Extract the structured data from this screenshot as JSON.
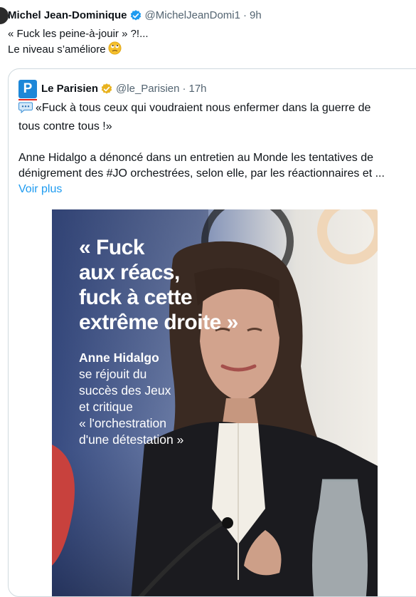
{
  "tweet": {
    "author_name": "Michel Jean-Dominique",
    "author_handle": "@MichelJeanDomi1",
    "separator": "·",
    "time": "9h",
    "text_line1": "« Fuck les peine-à-jouir » ?!...",
    "text_line2": "Le niveau s’améliore",
    "emoji": "face-with-rolling-eyes"
  },
  "quote": {
    "logo_letter": "P",
    "author_name": "Le Parisien",
    "author_handle": "@le_Parisien",
    "separator": "·",
    "time": "17h",
    "line1": "«Fuck à tous ceux qui voudraient nous enfermer dans la guerre de",
    "line2": "tous contre tous !»",
    "line3": "Anne Hidalgo a dénoncé dans un entretien au Monde les tentatives de",
    "line4": "dénigrement des #JO orchestrées, selon elle, par les réactionnaires et ...",
    "see_more": "Voir plus",
    "image": {
      "quote_lines": [
        "« Fuck",
        "aux réacs,",
        "fuck à cette",
        "extrême droite »"
      ],
      "desc_lines": [
        "Anne Hidalgo",
        "se réjouit du",
        "succès des Jeux",
        "et critique",
        "« l'orchestration",
        "d'une détestation »"
      ]
    }
  },
  "colors": {
    "link": "#1d9bf0",
    "secondary_text": "#536471",
    "verified_blue": "#1d9bf0",
    "verified_gold": "#e8b21f",
    "border": "#cfd9de"
  }
}
